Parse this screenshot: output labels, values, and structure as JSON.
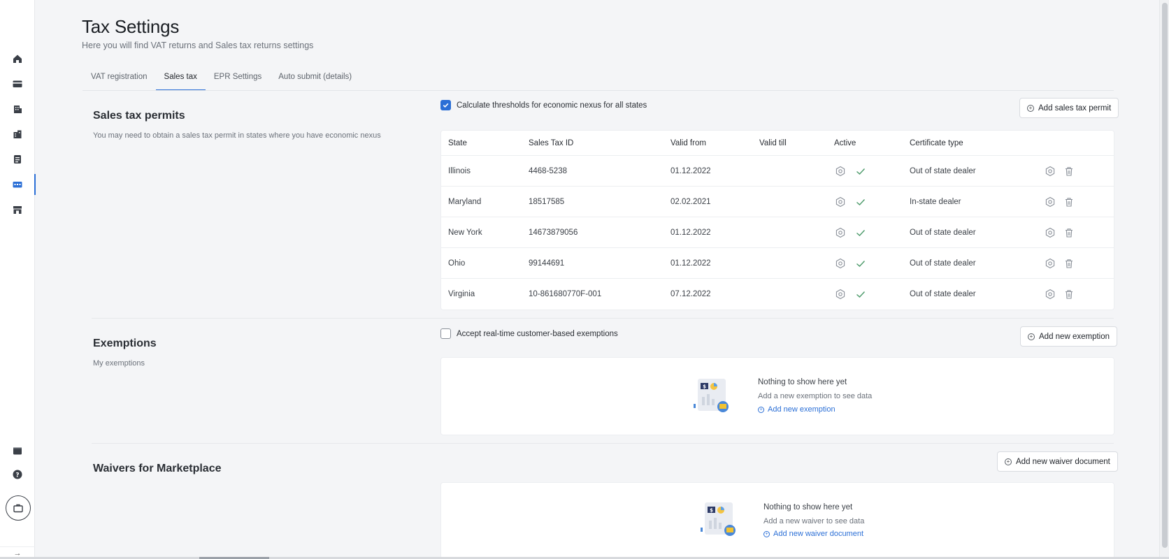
{
  "header": {
    "title": "Tax Settings",
    "subtitle": "Here you will find VAT returns and Sales tax returns settings"
  },
  "tabs": [
    {
      "label": "VAT registration",
      "active": false
    },
    {
      "label": "Sales tax",
      "active": true
    },
    {
      "label": "EPR Settings",
      "active": false
    },
    {
      "label": "Auto submit (details)",
      "active": false
    }
  ],
  "rail": {
    "items": [
      "home-icon",
      "card-icon",
      "building-icon",
      "building-alt-icon",
      "document-icon",
      "tax-icon",
      "store-icon"
    ],
    "active_index": 5,
    "bottom_items": [
      "wallet-icon",
      "help-icon"
    ],
    "briefcase": "briefcase-icon",
    "expand": "→"
  },
  "permits": {
    "title": "Sales tax permits",
    "description": "You may need to obtain a sales tax permit in states where you have economic nexus",
    "checkbox_label": "Calculate thresholds for economic nexus for all states",
    "checkbox_checked": true,
    "add_button": "Add sales tax permit",
    "columns": [
      "State",
      "Sales Tax ID",
      "Valid from",
      "Valid till",
      "Active",
      "Certificate type"
    ],
    "rows": [
      {
        "state": "Illinois",
        "id": "4468-5238",
        "from": "01.12.2022",
        "till": "",
        "cert": "Out of state dealer"
      },
      {
        "state": "Maryland",
        "id": "18517585",
        "from": "02.02.2021",
        "till": "",
        "cert": "In-state dealer"
      },
      {
        "state": "New York",
        "id": "14673879056",
        "from": "01.12.2022",
        "till": "",
        "cert": "Out of state dealer"
      },
      {
        "state": "Ohio",
        "id": "99144691",
        "from": "01.12.2022",
        "till": "",
        "cert": "Out of state dealer"
      },
      {
        "state": "Virginia",
        "id": "10-861680770F-001",
        "from": "07.12.2022",
        "till": "",
        "cert": "Out of state dealer"
      }
    ]
  },
  "exemptions": {
    "title": "Exemptions",
    "description": "My exemptions",
    "checkbox_label": "Accept real-time customer-based exemptions",
    "checkbox_checked": false,
    "add_button": "Add new exemption",
    "empty_title": "Nothing to show here yet",
    "empty_desc": "Add a new exemption to see data",
    "empty_link": "Add new exemption"
  },
  "waivers": {
    "title": "Waivers for Marketplace",
    "add_button": "Add new waiver document",
    "empty_title": "Nothing to show here yet",
    "empty_desc": "Add a new waiver to see data",
    "empty_link": "Add new waiver document"
  },
  "colors": {
    "accent": "#2b6fd6",
    "background": "#f4f5f7",
    "card": "#ffffff"
  }
}
